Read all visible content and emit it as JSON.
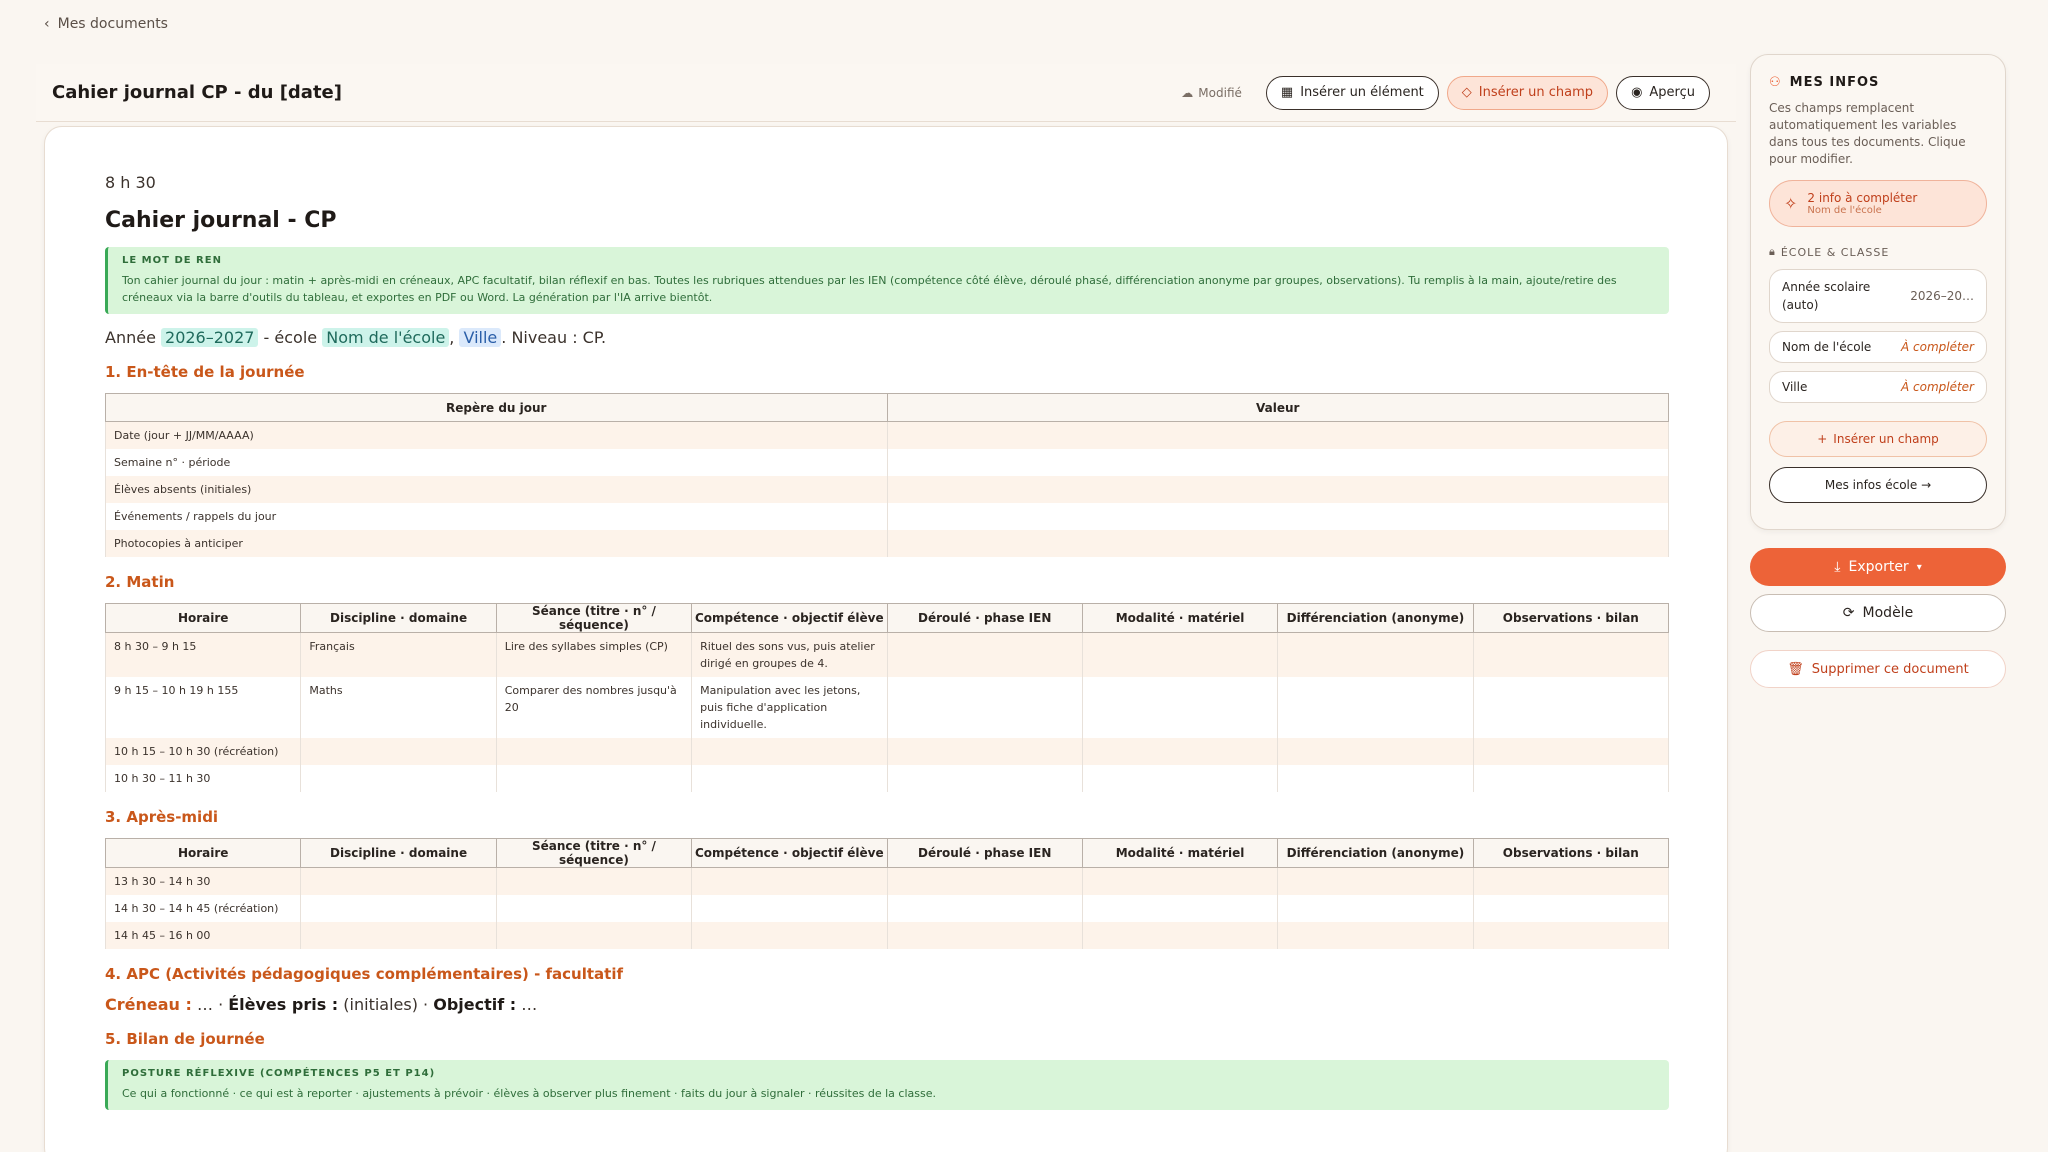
{
  "nav": {
    "back_label": "Mes documents"
  },
  "header": {
    "title": "Cahier journal CP - du [date]",
    "status": "Modifié",
    "insert_element": "Insérer un élément",
    "insert_field": "Insérer un champ",
    "preview": "Aperçu"
  },
  "doc": {
    "time": "8 h 30",
    "title": "Cahier journal - CP",
    "callout_title": "LE MOT DE REN",
    "callout_text": "Ton cahier journal du jour : matin + après-midi en créneaux, APC facultatif, bilan réflexif en bas. Toutes les rubriques attendues par les IEN (compétence côté élève, déroulé phasé, différenciation anonyme par groupes, observations). Tu remplis à la main, ajoute/retire des créneaux via la barre d'outils du tableau, et exportes en PDF ou Word. La génération par l'IA arrive bientôt.",
    "annee_prefix": "Année",
    "annee_value": "2026–2027",
    "ecole_prefix": "- école",
    "ecole_value": "Nom de l'école",
    "comma": ",",
    "ville_value": "Ville",
    "niveau_text": ". Niveau : CP.",
    "s1": {
      "title": "1. En-tête de la journée",
      "headers": [
        "Repère du jour",
        "Valeur"
      ],
      "rows": [
        [
          "Date (jour + JJ/MM/AAAA)",
          ""
        ],
        [
          "Semaine n° · période",
          ""
        ],
        [
          "Élèves absents (initiales)",
          ""
        ],
        [
          "Événements / rappels du jour",
          ""
        ],
        [
          "Photocopies à anticiper",
          ""
        ]
      ]
    },
    "s2": {
      "title": "2. Matin",
      "headers": [
        "Horaire",
        "Discipline · domaine",
        "Séance (titre · n° / séquence)",
        "Compétence · objectif élève",
        "Déroulé · phase IEN",
        "Modalité · matériel",
        "Différenciation (anonyme)",
        "Observations · bilan"
      ],
      "rows": [
        [
          "8 h 30 – 9 h 15",
          "Français",
          "Lire des syllabes simples (CP)",
          "Rituel des sons vus, puis atelier dirigé en groupes de 4.",
          "",
          "",
          "",
          ""
        ],
        [
          "9 h 15 – 10 h 19 h 155",
          "Maths",
          "Comparer des nombres jusqu'à 20",
          "Manipulation avec les jetons, puis fiche d'application individuelle.",
          "",
          "",
          "",
          ""
        ],
        [
          "10 h 15 – 10 h 30 (récréation)",
          "",
          "",
          "",
          "",
          "",
          "",
          ""
        ],
        [
          "10 h 30 – 11 h 30",
          "",
          "",
          "",
          "",
          "",
          "",
          ""
        ]
      ]
    },
    "s3": {
      "title": "3. Après-midi",
      "headers": [
        "Horaire",
        "Discipline · domaine",
        "Séance (titre · n° / séquence)",
        "Compétence · objectif élève",
        "Déroulé · phase IEN",
        "Modalité · matériel",
        "Différenciation (anonyme)",
        "Observations · bilan"
      ],
      "rows": [
        [
          "13 h 30 – 14 h 30",
          "",
          "",
          "",
          "",
          "",
          "",
          ""
        ],
        [
          "14 h 30 – 14 h 45 (récréation)",
          "",
          "",
          "",
          "",
          "",
          "",
          ""
        ],
        [
          "14 h 45 – 16 h 00",
          "",
          "",
          "",
          "",
          "",
          "",
          ""
        ]
      ]
    },
    "s4": {
      "title": "4. APC (Activités pédagogiques complémentaires) - facultatif",
      "creneau_label": "Créneau :",
      "creneau_value": " … · ",
      "eleves_label": "Élèves pris :",
      "eleves_value": " (initiales) · ",
      "objectif_label": "Objectif :",
      "objectif_value": " …"
    },
    "s5": {
      "title": "5. Bilan de journée",
      "callout_title": "POSTURE RÉFLEXIVE (COMPÉTENCES P5 ET P14)",
      "callout_text": "Ce qui a fonctionné · ce qui est à reporter · ajustements à prévoir · élèves à observer plus finement · faits du jour à signaler · réussites de la classe."
    }
  },
  "sidebar": {
    "title": "MES INFOS",
    "description": "Ces champs remplacent automatiquement les variables dans tous tes documents. Clique pour modifier.",
    "alert_main": "2 info à compléter",
    "alert_sub": "Nom de l'école",
    "section_label": "ÉCOLE & CLASSE",
    "fields": [
      {
        "label": "Année scolaire (auto)",
        "value": "2026–20…"
      },
      {
        "label": "Nom de l'école",
        "value": "À compléter"
      },
      {
        "label": "Ville",
        "value": "À compléter"
      }
    ],
    "insert_field": "Insérer un champ",
    "school_info": "Mes infos école →"
  },
  "actions": {
    "export": "Exporter",
    "template": "Modèle",
    "delete": "Supprimer ce document"
  }
}
